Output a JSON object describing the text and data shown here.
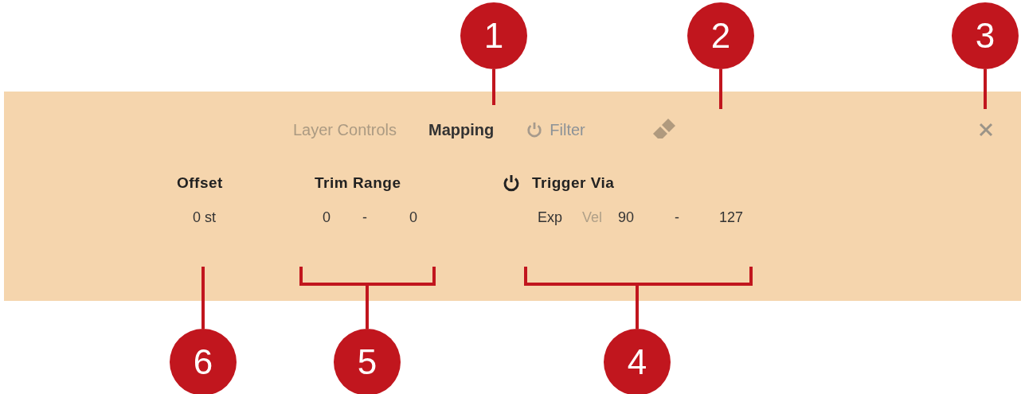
{
  "tabs": [
    {
      "label": "Layer Controls",
      "selected": false,
      "kind": "plain"
    },
    {
      "label": "Mapping",
      "selected": true,
      "kind": "plain"
    },
    {
      "label": "Filter",
      "selected": false,
      "kind": "toggle",
      "on": false
    }
  ],
  "sections": [
    {
      "title": "Offset",
      "values": [
        {
          "text": "0 st",
          "selected": true
        }
      ]
    },
    {
      "title": "Trim Range",
      "values": [
        {
          "text": "0",
          "selected": true
        },
        {
          "text": "-",
          "selected": true
        },
        {
          "text": "0",
          "selected": true
        }
      ]
    },
    {
      "title": "Trigger Via",
      "on": true,
      "values": [
        {
          "text": "Exp",
          "selected": true
        },
        {
          "text": "Vel",
          "selected": false
        },
        {
          "text": "90",
          "selected": true
        },
        {
          "text": "-",
          "selected": true
        },
        {
          "text": "127",
          "selected": true
        }
      ]
    }
  ],
  "callouts": [
    "1",
    "2",
    "3",
    "6",
    "5",
    "4"
  ]
}
